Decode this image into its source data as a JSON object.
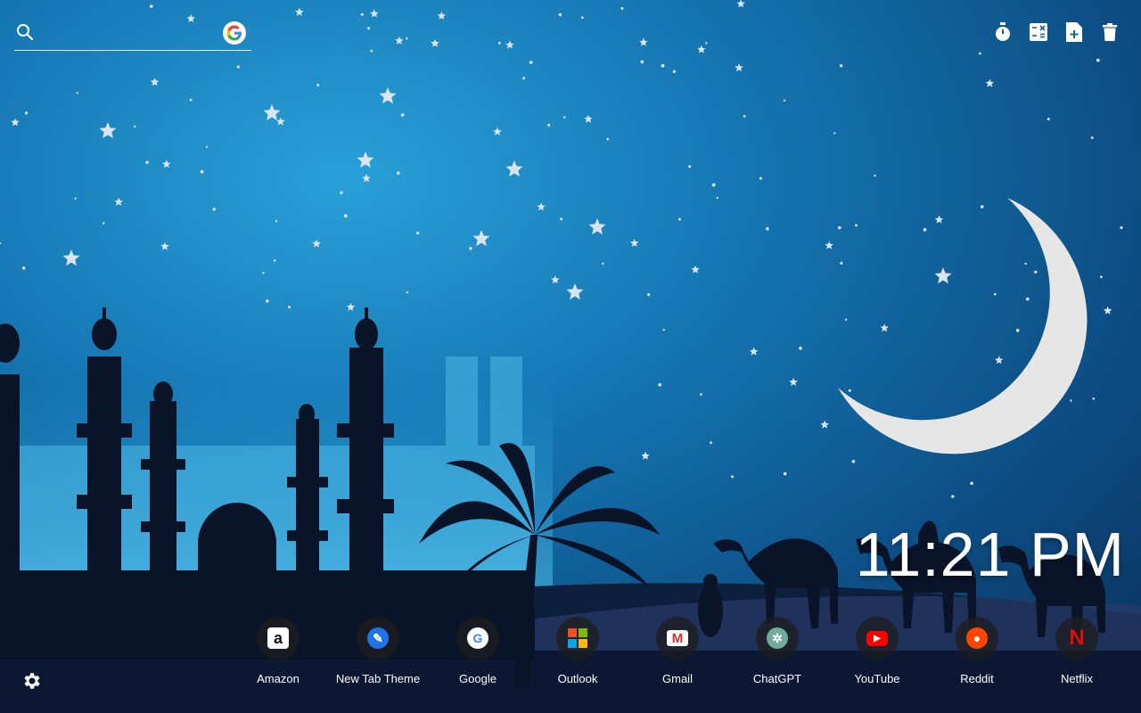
{
  "search": {
    "placeholder": "",
    "engine_icon": "google-icon"
  },
  "toolbar": {
    "items": [
      {
        "icon": "stopwatch-icon"
      },
      {
        "icon": "calculator-icon"
      },
      {
        "icon": "add-note-icon"
      },
      {
        "icon": "trash-icon"
      }
    ]
  },
  "clock": {
    "time": "11:21 PM"
  },
  "shortcuts": [
    {
      "label": "Amazon",
      "icon": "amazon-icon",
      "glyph": "a",
      "color": "#ffffff",
      "fg": "#111111"
    },
    {
      "label": "New Tab Theme",
      "icon": "new-tab-theme-icon",
      "glyph": "✎",
      "color": "#1e73e8",
      "fg": "#ffffff"
    },
    {
      "label": "Google",
      "icon": "google-icon",
      "glyph": "G",
      "color": "#ffffff",
      "fg": "#4285f4"
    },
    {
      "label": "Outlook",
      "icon": "outlook-icon",
      "glyph": "",
      "color": "#ffffff",
      "fg": "#ffffff"
    },
    {
      "label": "Gmail",
      "icon": "gmail-icon",
      "glyph": "M",
      "color": "#ffffff",
      "fg": "#d93025"
    },
    {
      "label": "ChatGPT",
      "icon": "chatgpt-icon",
      "glyph": "✲",
      "color": "#74aa9c",
      "fg": "#ffffff"
    },
    {
      "label": "YouTube",
      "icon": "youtube-icon",
      "glyph": "▶",
      "color": "#ff0000",
      "fg": "#ffffff"
    },
    {
      "label": "Reddit",
      "icon": "reddit-icon",
      "glyph": "●",
      "color": "#ff4500",
      "fg": "#ffffff"
    },
    {
      "label": "Netflix",
      "icon": "netflix-icon",
      "glyph": "N",
      "color": "#141414",
      "fg": "#e50914"
    }
  ],
  "settings": {
    "icon": "gear-icon"
  }
}
